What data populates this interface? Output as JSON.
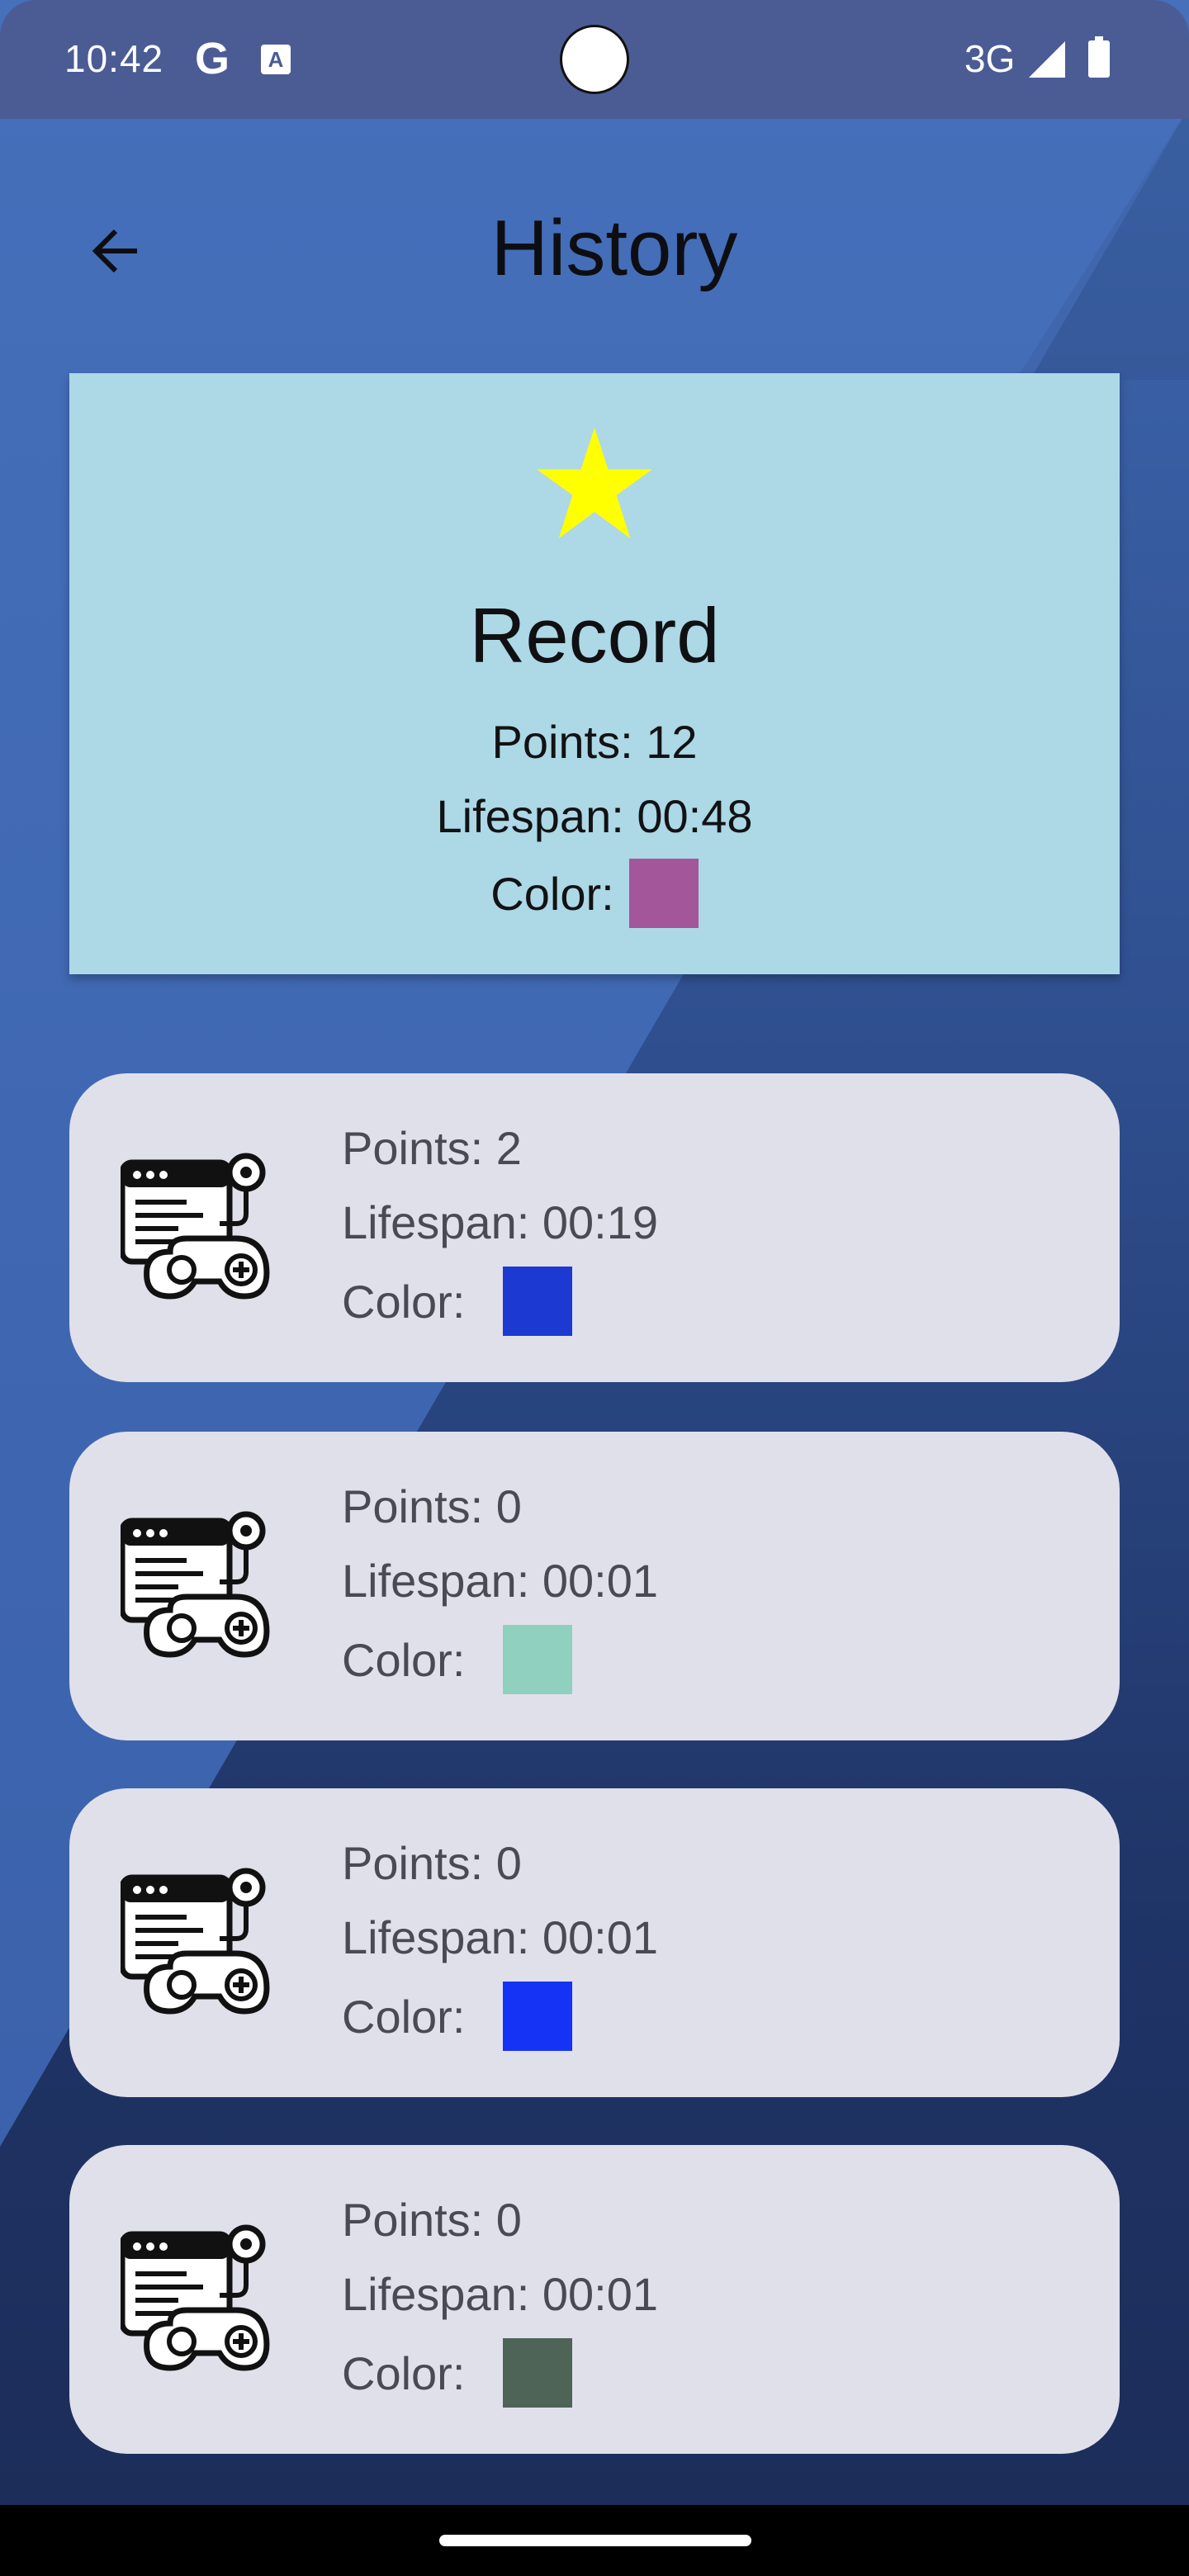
{
  "status_bar": {
    "time": "10:42",
    "g_label": "G",
    "a_label": "A",
    "network": "3G"
  },
  "header": {
    "title": "History"
  },
  "record": {
    "title": "Record",
    "points": "Points: 12",
    "lifespan": "Lifespan: 00:48",
    "color_label": "Color:",
    "color": "#a3569a"
  },
  "history": [
    {
      "points": "Points: 2",
      "lifespan": "Lifespan: 00:19",
      "color_label": "Color:",
      "color": "#1c39d1"
    },
    {
      "points": "Points: 0",
      "lifespan": "Lifespan: 00:01",
      "color_label": "Color:",
      "color": "#90d0bf"
    },
    {
      "points": "Points: 0",
      "lifespan": "Lifespan: 00:01",
      "color_label": "Color:",
      "color": "#1433f5"
    },
    {
      "points": "Points: 0",
      "lifespan": "Lifespan: 00:01",
      "color_label": "Color:",
      "color": "#4d6457"
    }
  ]
}
